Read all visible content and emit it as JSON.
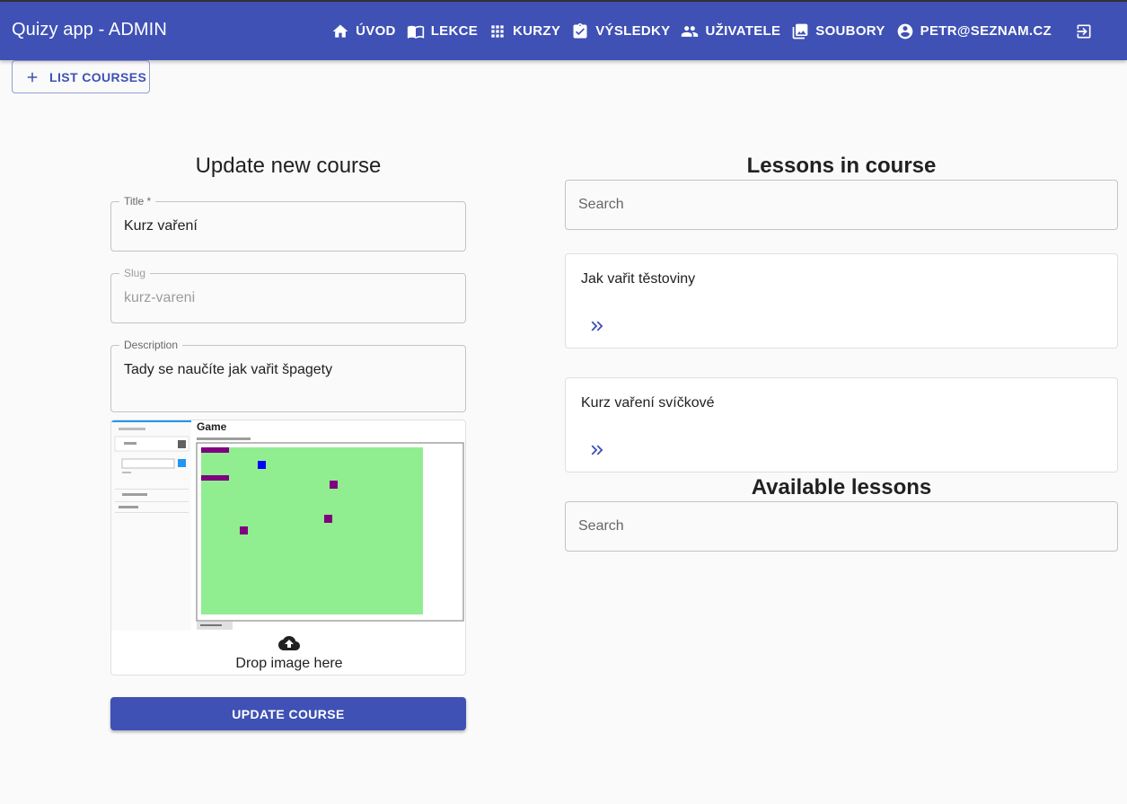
{
  "app": {
    "title": "Quizy app - ADMIN"
  },
  "nav": {
    "items": [
      {
        "label": "ÚVOD",
        "icon": "home-icon"
      },
      {
        "label": "LEKCE",
        "icon": "book-icon"
      },
      {
        "label": "KURZY",
        "icon": "grid-icon"
      },
      {
        "label": "VÝSLEDKY",
        "icon": "check-clipboard-icon"
      },
      {
        "label": "UŽIVATELE",
        "icon": "people-icon"
      },
      {
        "label": "SOUBORY",
        "icon": "photo-library-icon"
      },
      {
        "label": "PETR@SEZNAM.CZ",
        "icon": "account-circle-icon"
      }
    ],
    "logout_icon": "logout-icon"
  },
  "toolbar": {
    "list_courses_label": "LIST COURSES"
  },
  "form": {
    "title": "Update new course",
    "fields": {
      "title": {
        "label": "Title *",
        "value": "Kurz vaření"
      },
      "slug": {
        "label": "Slug",
        "value": "kurz-vareni"
      },
      "description": {
        "label": "Description",
        "value": "Tady se naučíte jak vařit špagety"
      }
    },
    "image": {
      "preview_heading": "Game",
      "drop_text": "Drop image here"
    },
    "submit_label": "UPDATE COURSE"
  },
  "lessons_in_course": {
    "title": "Lessons in course",
    "search_placeholder": "Search",
    "items": [
      {
        "title": "Jak vařit těstoviny"
      },
      {
        "title": "Kurz vaření svíčkové"
      }
    ]
  },
  "available_lessons": {
    "title": "Available lessons",
    "search_placeholder": "Search"
  },
  "colors": {
    "primary": "#3f51b5",
    "background": "#fafafa",
    "game_field": "#90ee90"
  }
}
